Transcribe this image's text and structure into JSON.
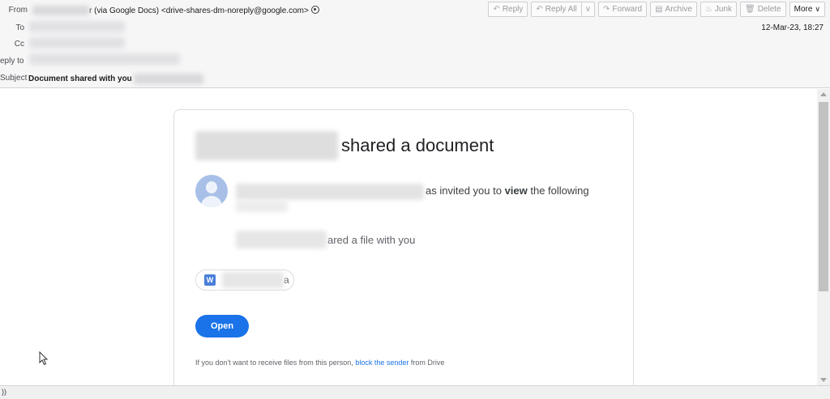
{
  "header": {
    "from_label": "From",
    "from_suffix": "r (via Google Docs) <drive-shares-dm-noreply@google.com>",
    "to_label": "To",
    "cc_label": "Cc",
    "replyto_label": "eply to",
    "subject_label": "Subject",
    "subject_value": "Document shared with you",
    "date": "12-Mar-23, 18:27"
  },
  "toolbar": {
    "reply": "Reply",
    "reply_all": "Reply All",
    "forward": "Forward",
    "archive": "Archive",
    "junk": "Junk",
    "delete": "Delete",
    "more": "More"
  },
  "message": {
    "headline": "shared a document",
    "invite_text_1": "as invited you to ",
    "invite_bold": "view",
    "invite_text_2": " the following",
    "shared_text": "ared a file with you",
    "file_suffix": "a",
    "file_icon_letter": "W",
    "open_button": "Open",
    "footer_prefix": "If you don't want to receive files from this person, ",
    "footer_link": "block the sender",
    "footer_suffix": " from Drive"
  },
  "statusbar": {
    "text": "))"
  },
  "colors": {
    "accent": "#1a73e8",
    "header_bg": "#f6f6f7"
  }
}
